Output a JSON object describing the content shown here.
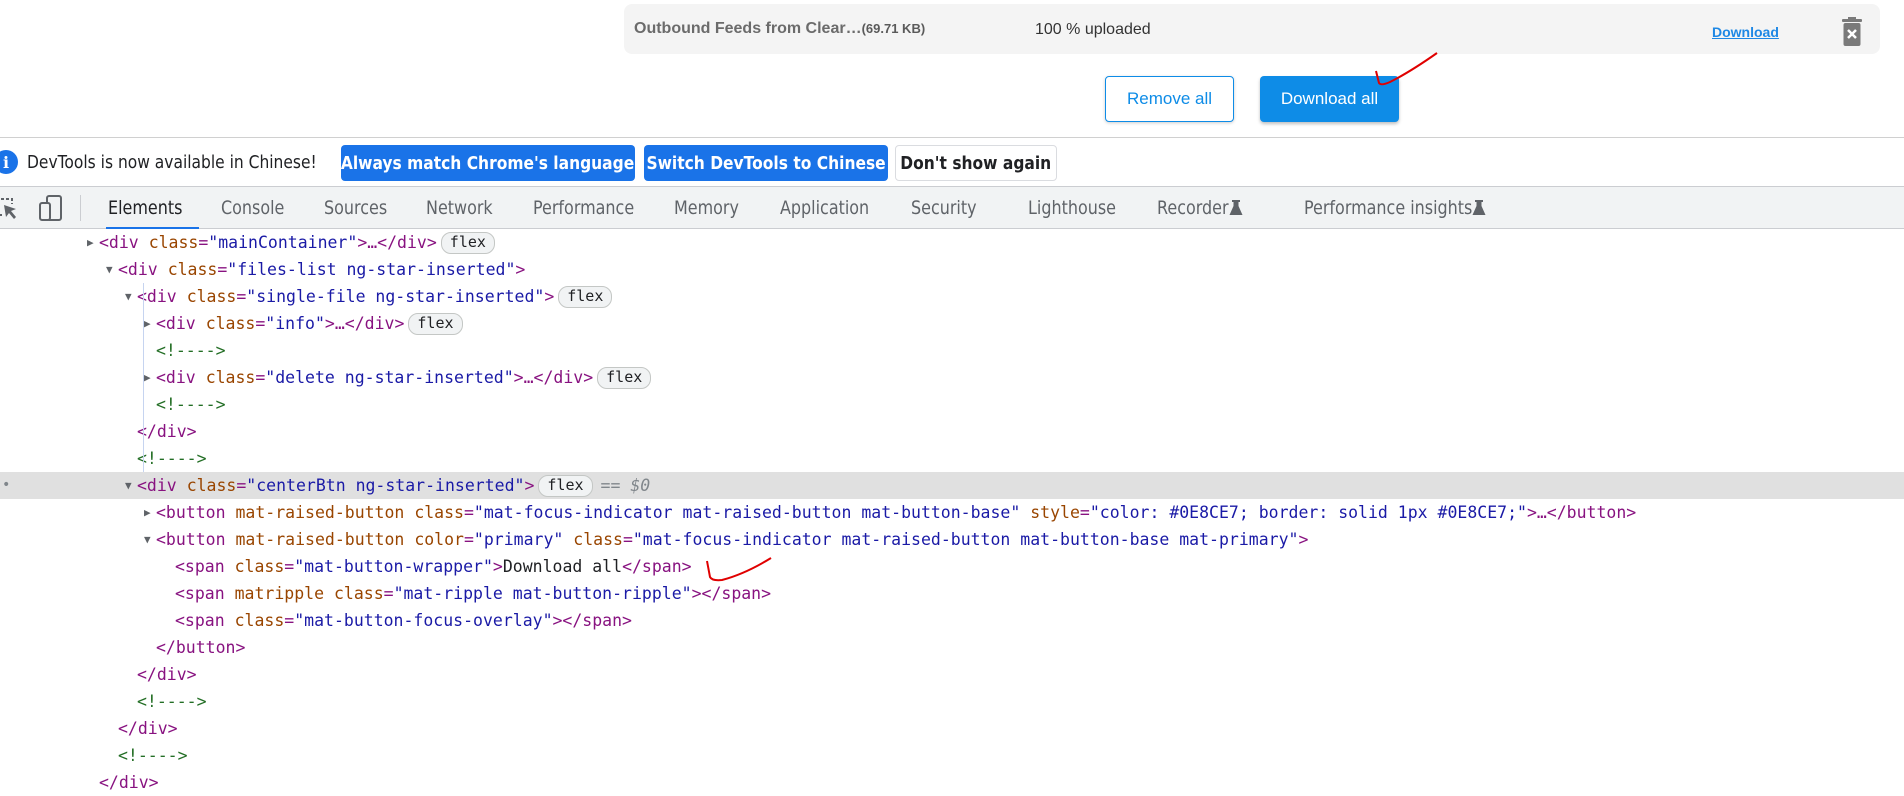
{
  "page": {
    "file_card": {
      "file_name": "Outbound Feeds from Clear…",
      "file_size": "(69.71 KB)",
      "status": "100 % uploaded",
      "download_link": "Download",
      "delete_icon": "trash-icon"
    },
    "buttons": {
      "remove_all": "Remove all",
      "download_all": "Download all"
    },
    "colors": {
      "accent": "#0E8CE7",
      "annotation": "#E00000"
    }
  },
  "infobar": {
    "icon": "info-icon",
    "message": "DevTools is now available in Chinese!",
    "btn_always_match": "Always match Chrome's language",
    "btn_switch": "Switch DevTools to Chinese",
    "btn_dont_show": "Don't show again"
  },
  "devtools": {
    "toolbar_icons": [
      "inspect-element-icon",
      "device-toolbar-icon"
    ],
    "tabs": [
      {
        "label": "Elements",
        "active": true
      },
      {
        "label": "Console"
      },
      {
        "label": "Sources"
      },
      {
        "label": "Network"
      },
      {
        "label": "Performance"
      },
      {
        "label": "Memory"
      },
      {
        "label": "Application"
      },
      {
        "label": "Security"
      },
      {
        "label": "Lighthouse"
      },
      {
        "label": "Recorder",
        "experimental": true
      },
      {
        "label": "Performance insights",
        "experimental": true
      }
    ],
    "flex_badge": "flex",
    "selected_marker": "== $0",
    "tree": [
      {
        "open": "<div",
        "attrs": [
          [
            "class",
            "mainContainer"
          ]
        ],
        "tail": ">…</div>",
        "badge": true,
        "toggle": "collapsed"
      },
      {
        "open": "<div",
        "attrs": [
          [
            "class",
            "files-list ng-star-inserted"
          ]
        ],
        "tail": ">",
        "toggle": "expanded"
      },
      {
        "open": "<div",
        "attrs": [
          [
            "class",
            "single-file ng-star-inserted"
          ]
        ],
        "tail": ">",
        "badge": true,
        "toggle": "expanded"
      },
      {
        "open": "<div",
        "attrs": [
          [
            "class",
            "info"
          ]
        ],
        "tail": ">…</div>",
        "badge": true,
        "toggle": "collapsed"
      },
      {
        "comment": "<!---->"
      },
      {
        "open": "<div",
        "attrs": [
          [
            "class",
            "delete ng-star-inserted"
          ]
        ],
        "tail": ">…</div>",
        "badge": true,
        "toggle": "collapsed"
      },
      {
        "comment": "<!---->"
      },
      {
        "close": "</div>"
      },
      {
        "comment": "<!---->"
      },
      {
        "open": "<div",
        "attrs": [
          [
            "class",
            "centerBtn ng-star-inserted"
          ]
        ],
        "tail": ">",
        "badge": true,
        "toggle": "expanded",
        "selected": true
      },
      {
        "open": "<button",
        "attrs": [
          [
            "mat-raised-button",
            null
          ],
          [
            "class",
            "mat-focus-indicator mat-raised-button mat-button-base"
          ],
          [
            "style",
            "color: #0E8CE7; border: solid 1px #0E8CE7;"
          ]
        ],
        "tail": ">…</button>",
        "toggle": "collapsed"
      },
      {
        "open": "<button",
        "attrs": [
          [
            "mat-raised-button",
            null
          ],
          [
            "color",
            "primary"
          ],
          [
            "class",
            "mat-focus-indicator mat-raised-button mat-button-base mat-primary"
          ]
        ],
        "tail": ">",
        "toggle": "expanded"
      },
      {
        "open": "<span",
        "attrs": [
          [
            "class",
            "mat-button-wrapper"
          ]
        ],
        "tail": ">",
        "text": "Download all",
        "close_tag": "</span>"
      },
      {
        "open": "<span",
        "attrs": [
          [
            "matripple",
            null
          ],
          [
            "class",
            "mat-ripple mat-button-ripple"
          ]
        ],
        "tail": "></span>"
      },
      {
        "open": "<span",
        "attrs": [
          [
            "class",
            "mat-button-focus-overlay"
          ]
        ],
        "tail": "></span>"
      },
      {
        "close": "</button>"
      },
      {
        "close": "</div>"
      },
      {
        "comment": "<!---->"
      },
      {
        "close": "</div>"
      },
      {
        "comment": "<!---->"
      },
      {
        "close": "</div>"
      }
    ]
  }
}
